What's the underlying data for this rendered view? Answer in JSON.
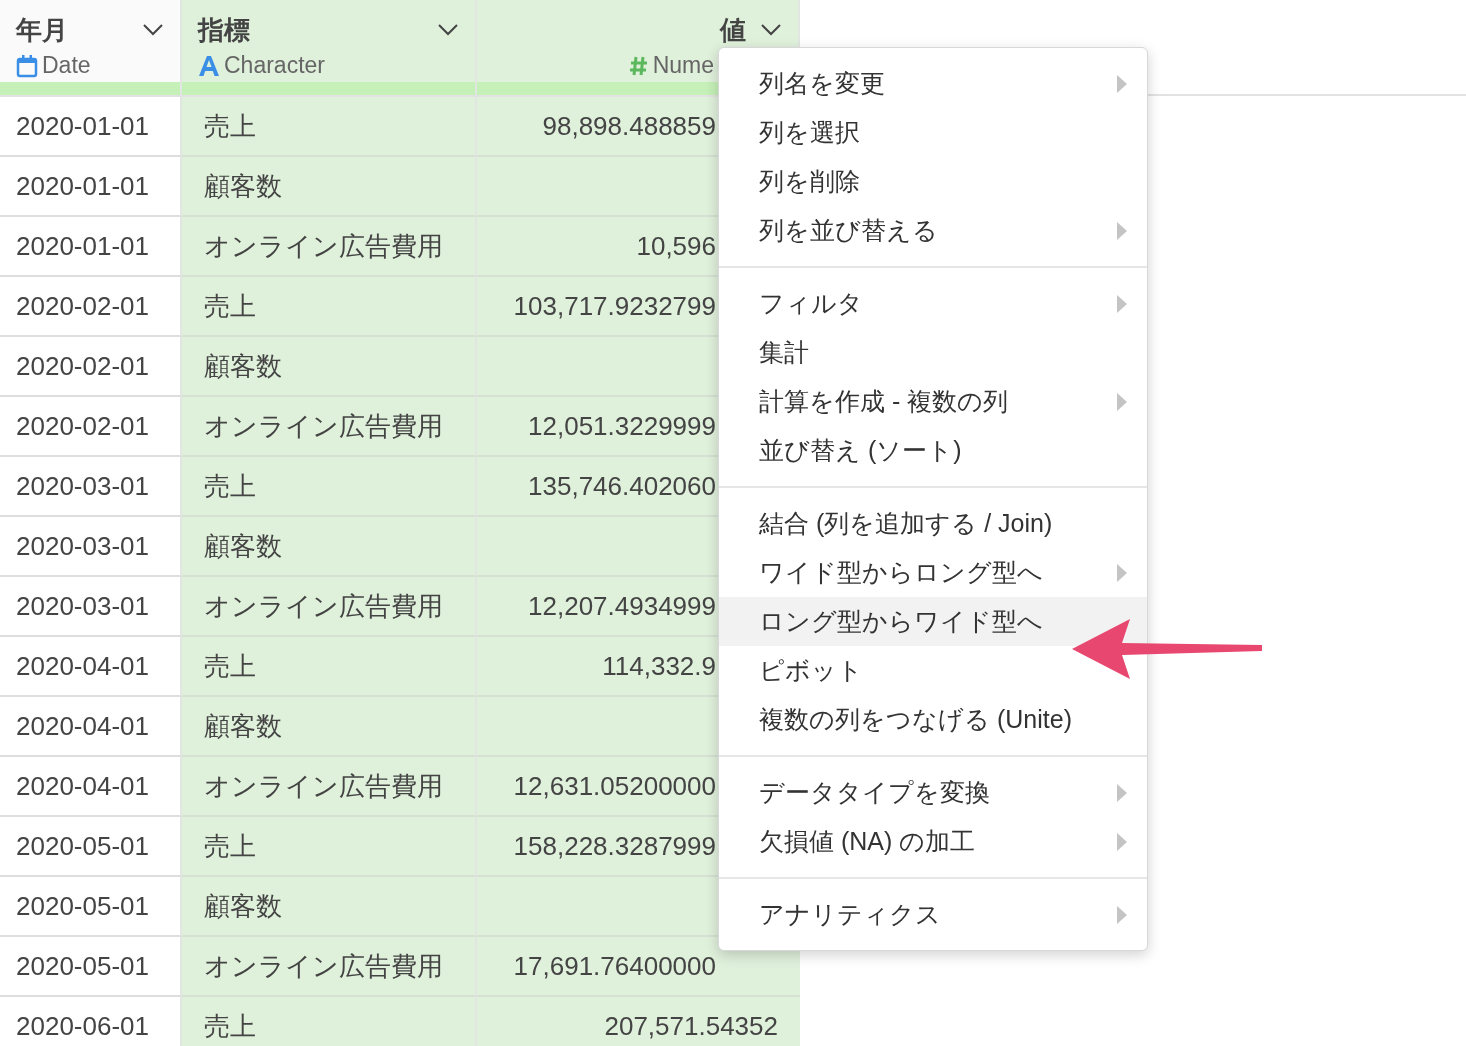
{
  "table": {
    "columns": [
      {
        "name": "年月",
        "type": "Date",
        "kind": "date"
      },
      {
        "name": "指標",
        "type": "Character",
        "kind": "character"
      },
      {
        "name": "値",
        "type": "Nume",
        "kind": "number"
      }
    ],
    "rows": [
      {
        "date": "2020-01-01",
        "metric": "売上",
        "value": "98,898.488859"
      },
      {
        "date": "2020-01-01",
        "metric": "顧客数"
      },
      {
        "date": "2020-01-01",
        "metric": "オンライン広告費用",
        "value": "10,596"
      },
      {
        "date": "2020-02-01",
        "metric": "売上",
        "value": "103,717.9232799"
      },
      {
        "date": "2020-02-01",
        "metric": "顧客数"
      },
      {
        "date": "2020-02-01",
        "metric": "オンライン広告費用",
        "value": "12,051.3229999"
      },
      {
        "date": "2020-03-01",
        "metric": "売上",
        "value": "135,746.402060"
      },
      {
        "date": "2020-03-01",
        "metric": "顧客数"
      },
      {
        "date": "2020-03-01",
        "metric": "オンライン広告費用",
        "value": "12,207.4934999"
      },
      {
        "date": "2020-04-01",
        "metric": "売上",
        "value": "114,332.9"
      },
      {
        "date": "2020-04-01",
        "metric": "顧客数"
      },
      {
        "date": "2020-04-01",
        "metric": "オンライン広告費用",
        "value": "12,631.05200000"
      },
      {
        "date": "2020-05-01",
        "metric": "売上",
        "value": "158,228.3287999"
      },
      {
        "date": "2020-05-01",
        "metric": "顧客数"
      },
      {
        "date": "2020-05-01",
        "metric": "オンライン広告費用",
        "value": "17,691.76400000"
      },
      {
        "date": "2020-06-01",
        "metric": "売上",
        "value": "207,571.54352"
      }
    ]
  },
  "context_menu": {
    "sections": [
      {
        "items": [
          {
            "label": "列名を変更",
            "submenu": true,
            "selected": false
          },
          {
            "label": "列を選択",
            "submenu": false,
            "selected": false
          },
          {
            "label": "列を削除",
            "submenu": false,
            "selected": false
          },
          {
            "label": "列を並び替える",
            "submenu": true,
            "selected": false
          }
        ]
      },
      {
        "items": [
          {
            "label": "フィルタ",
            "submenu": true,
            "selected": false
          },
          {
            "label": "集計",
            "submenu": false,
            "selected": false
          },
          {
            "label": "計算を作成 - 複数の列",
            "submenu": true,
            "selected": false
          },
          {
            "label": "並び替え (ソート)",
            "submenu": false,
            "selected": false
          }
        ]
      },
      {
        "items": [
          {
            "label": "結合 (列を追加する / Join)",
            "submenu": false,
            "selected": false
          },
          {
            "label": "ワイド型からロング型へ",
            "submenu": true,
            "selected": false
          },
          {
            "label": "ロング型からワイド型へ",
            "submenu": false,
            "selected": true
          },
          {
            "label": "ピボット",
            "submenu": false,
            "selected": false
          },
          {
            "label": "複数の列をつなげる (Unite)",
            "submenu": false,
            "selected": false
          }
        ]
      },
      {
        "items": [
          {
            "label": "データタイプを変換",
            "submenu": true,
            "selected": false
          },
          {
            "label": "欠損値 (NA) の加工",
            "submenu": true,
            "selected": false
          }
        ]
      },
      {
        "items": [
          {
            "label": "アナリティクス",
            "submenu": true,
            "selected": false
          }
        ]
      }
    ]
  }
}
